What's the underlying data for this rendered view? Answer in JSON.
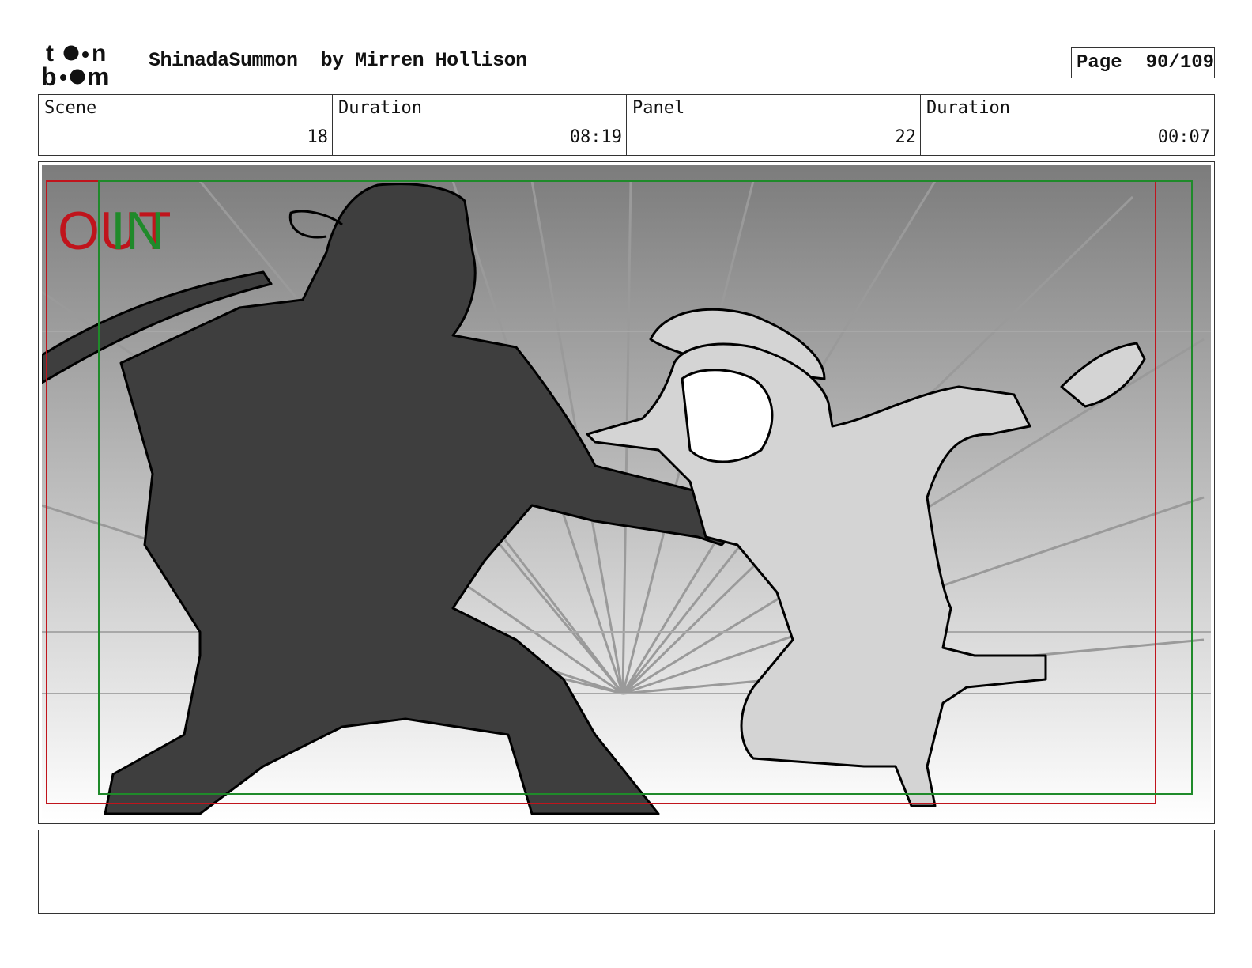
{
  "header": {
    "logo_text": "toon boom",
    "project_title": "ShinadaSummon",
    "by_line": "by Mirren Hollison",
    "page_label": "Page",
    "page_value": "90/109"
  },
  "info": {
    "scene_label": "Scene",
    "scene_value": "18",
    "scene_duration_label": "Duration",
    "scene_duration_value": "08:19",
    "panel_label": "Panel",
    "panel_value": "22",
    "panel_duration_label": "Duration",
    "panel_duration_value": "00:07"
  },
  "panel": {
    "camera_marker_out": "OUT",
    "camera_marker_in": "IN",
    "out_frame_color": "#c0141c",
    "in_frame_color": "#1f8a2a",
    "gradient_top": "#7c7c7c",
    "gradient_bottom": "#ffffff",
    "left_figure_fill": "#3e3e3e",
    "right_figure_fill": "#d4d4d4"
  },
  "notes": {
    "text": ""
  }
}
